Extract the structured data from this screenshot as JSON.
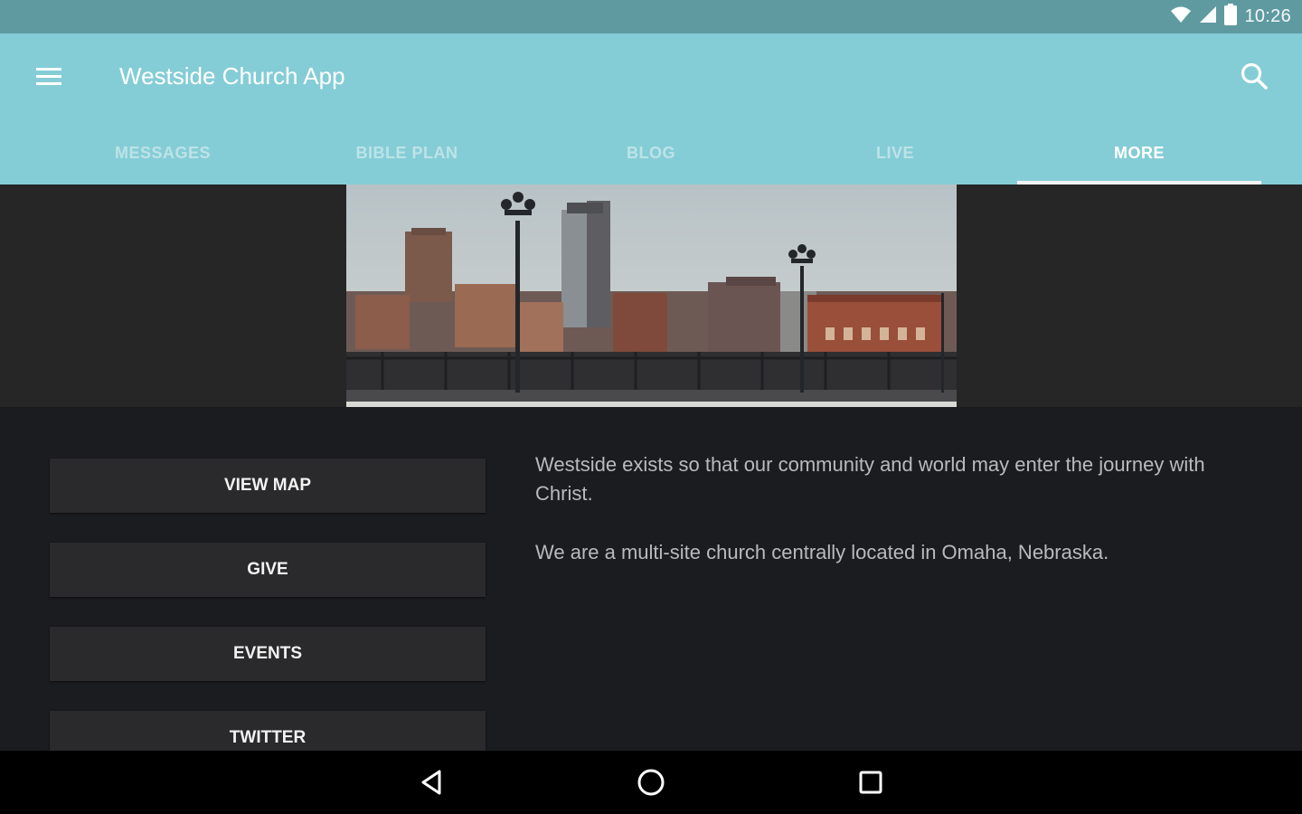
{
  "status_bar": {
    "time": "10:26",
    "icons": [
      "wifi-icon",
      "cell-signal-icon",
      "battery-icon"
    ]
  },
  "app_bar": {
    "title": "Westside Church App",
    "menu_icon": "hamburger-menu-icon",
    "search_icon": "search-icon",
    "background_color": "#85cdd6"
  },
  "tabs": [
    {
      "label": "MESSAGES",
      "active": false
    },
    {
      "label": "BIBLE PLAN",
      "active": false
    },
    {
      "label": "BLOG",
      "active": false
    },
    {
      "label": "LIVE",
      "active": false
    },
    {
      "label": "MORE",
      "active": true
    }
  ],
  "hero": {
    "image": "city-skyline-photo"
  },
  "buttons": [
    {
      "label": "VIEW MAP"
    },
    {
      "label": "GIVE"
    },
    {
      "label": "EVENTS"
    },
    {
      "label": "TWITTER"
    }
  ],
  "description": {
    "paragraphs": [
      "Westside exists so that our community and world may enter the journey with Christ.",
      "We are a multi-site church centrally located in Omaha, Nebraska."
    ]
  },
  "nav_bar": {
    "icons": [
      "back-icon",
      "home-icon",
      "recent-apps-icon"
    ]
  }
}
